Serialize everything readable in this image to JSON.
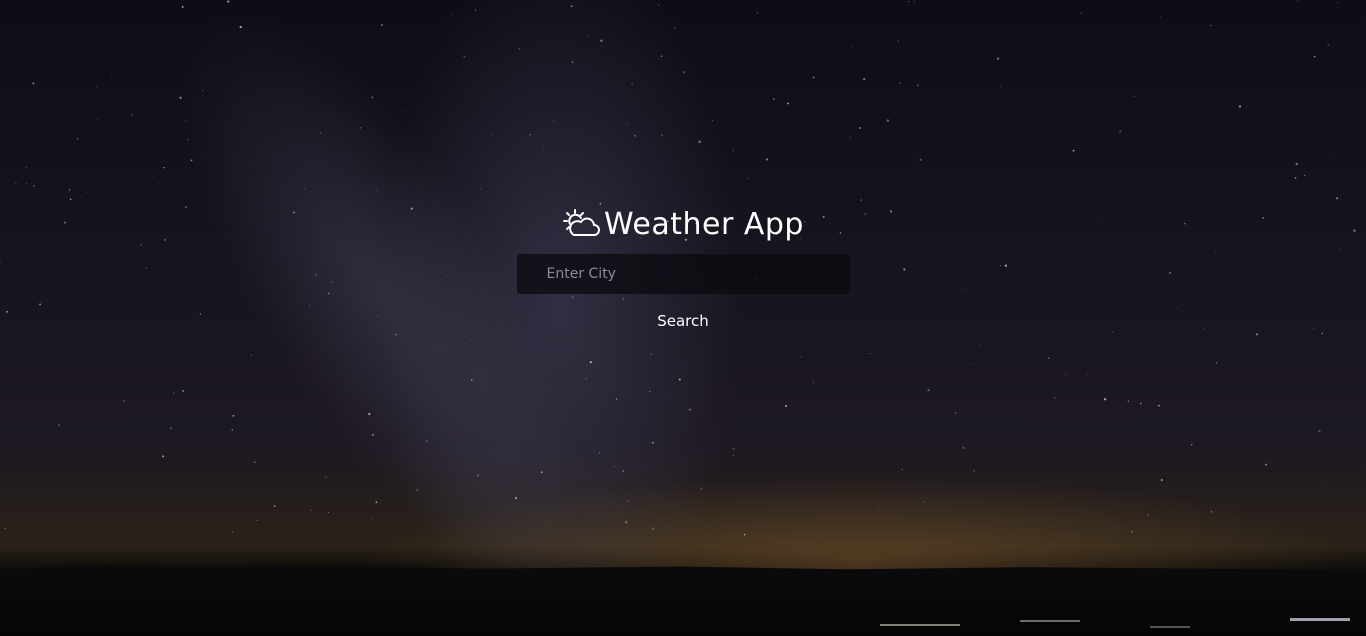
{
  "app": {
    "title": "Weather App",
    "icon": "sun-behind-cloud-icon"
  },
  "search": {
    "placeholder": "Enter City",
    "value": "",
    "button_label": "Search"
  },
  "colors": {
    "text": "#ffffff",
    "input_background": "#0c0a10",
    "placeholder": "#8d8b94"
  }
}
